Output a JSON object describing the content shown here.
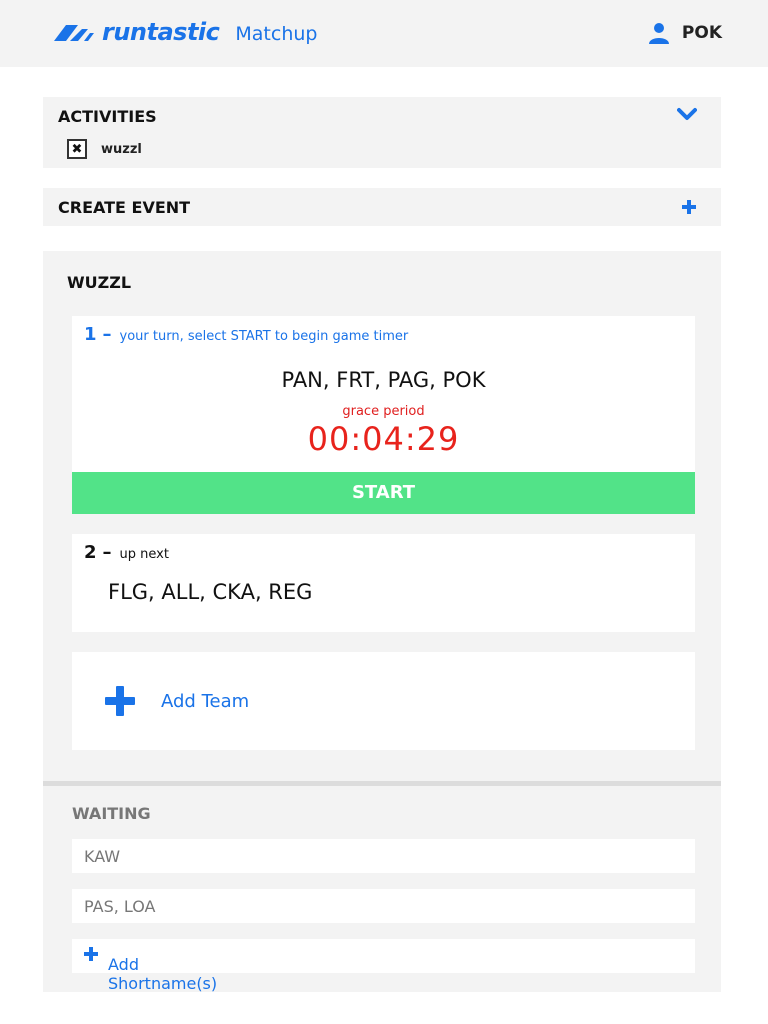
{
  "header": {
    "logo_text": "runtastic",
    "app_name": "Matchup",
    "username": "POK",
    "icons": {
      "logo": "runtastic-logo-icon",
      "user": "user-icon"
    }
  },
  "activities": {
    "title": "ACTIVITIES",
    "items": [
      {
        "label": "wuzzl",
        "checked_mark": "✖"
      }
    ],
    "icon": "chevron-down-icon"
  },
  "create_event": {
    "title": "CREATE EVENT",
    "icon": "plus-icon"
  },
  "event": {
    "title": "WUZZL",
    "current": {
      "number": "1",
      "dash": "–",
      "instruction": "your turn, select START to begin game timer",
      "teams": "PAN, FRT, PAG, POK",
      "grace_label": "grace period",
      "timer": "00:04:29",
      "start_label": "START"
    },
    "next": {
      "number": "2",
      "dash": "–",
      "label": "up next",
      "teams": "FLG, ALL, CKA, REG"
    },
    "add_team_label": "Add Team"
  },
  "waiting": {
    "title": "WAITING",
    "entries": [
      "KAW",
      "PAS, LOA"
    ],
    "add_shortname_label": "Add Shortname(s)"
  },
  "colors": {
    "accent": "#1a73e8",
    "start_green": "#52e388",
    "timer_red": "#e8231c",
    "panel_bg": "#f3f3f3"
  }
}
